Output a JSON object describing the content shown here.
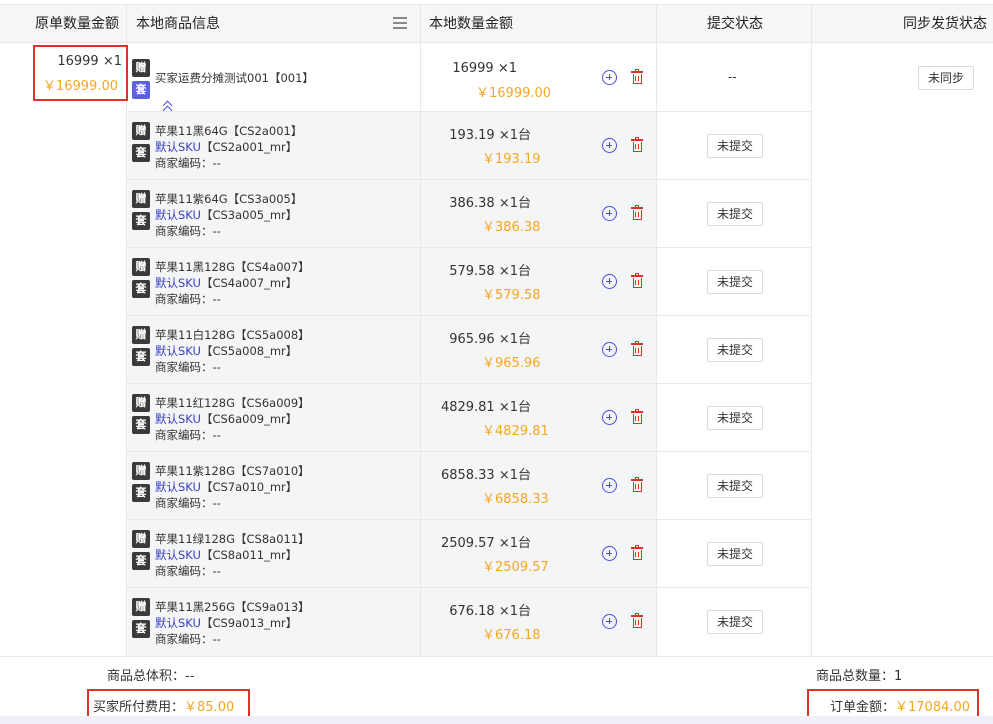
{
  "columns": {
    "original_amount": "原单数量金额",
    "local_product": "本地商品信息",
    "local_amount": "本地数量金额",
    "submit_status": "提交状态",
    "sync_status": "同步发货状态"
  },
  "original": {
    "qty": "16999 ×1",
    "price": "￥16999.00"
  },
  "parent": {
    "name": "买家运费分摊测试001【001】",
    "qty": "16999 ×1",
    "price": "￥16999.00",
    "submit_status": "--",
    "sync_button": "未同步"
  },
  "badges": {
    "gift": "赠",
    "set": "套"
  },
  "labels": {
    "default_sku": "默认SKU",
    "merchant_code": "商家编码：--"
  },
  "rows": [
    {
      "name": "苹果11黑64G【CS2a001】",
      "sku": "【CS2a001_mr】",
      "qty": "193.19 ×1台",
      "price": "￥193.19",
      "status": "未提交"
    },
    {
      "name": "苹果11紫64G【CS3a005】",
      "sku": "【CS3a005_mr】",
      "qty": "386.38 ×1台",
      "price": "￥386.38",
      "status": "未提交"
    },
    {
      "name": "苹果11黑128G【CS4a007】",
      "sku": "【CS4a007_mr】",
      "qty": "579.58 ×1台",
      "price": "￥579.58",
      "status": "未提交"
    },
    {
      "name": "苹果11白128G【CS5a008】",
      "sku": "【CS5a008_mr】",
      "qty": "965.96 ×1台",
      "price": "￥965.96",
      "status": "未提交"
    },
    {
      "name": "苹果11红128G【CS6a009】",
      "sku": "【CS6a009_mr】",
      "qty": "4829.81 ×1台",
      "price": "￥4829.81",
      "status": "未提交"
    },
    {
      "name": "苹果11紫128G【CS7a010】",
      "sku": "【CS7a010_mr】",
      "qty": "6858.33 ×1台",
      "price": "￥6858.33",
      "status": "未提交"
    },
    {
      "name": "苹果11绿128G【CS8a011】",
      "sku": "【CS8a011_mr】",
      "qty": "2509.57 ×1台",
      "price": "￥2509.57",
      "status": "未提交"
    },
    {
      "name": "苹果11黑256G【CS9a013】",
      "sku": "【CS9a013_mr】",
      "qty": "676.18 ×1台",
      "price": "￥676.18",
      "status": "未提交"
    }
  ],
  "footer": {
    "volume_label": "商品总体积：",
    "volume_value": "--",
    "count_label": "商品总数量：",
    "count_value": "1",
    "buyer_fee_label": "买家所付费用：",
    "buyer_fee_value": "￥85.00",
    "order_amount_label": "订单金额：",
    "order_amount_value": "￥17084.00"
  },
  "colors": {
    "accent_red": "#e0302c",
    "price_orange": "#f5a623",
    "sku_blue": "#3b3fc4",
    "icon_blue": "#4a4fd8"
  }
}
